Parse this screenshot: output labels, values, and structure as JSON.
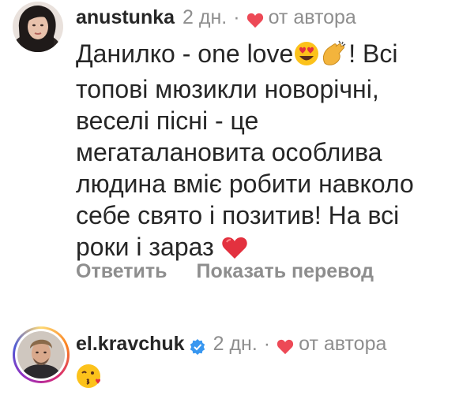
{
  "comments": [
    {
      "username": "anustunka",
      "time": "2 дн.",
      "separator": "·",
      "liked_by_author": "от автора",
      "lines": [
        "Данилко - one love",
        "! Всі",
        "топові мюзикли новорічні,",
        "веселі пісні - це",
        "мегаталановита особлива",
        "людина вміє робити навколо",
        "себе свято і позитив! На всі",
        "роки і зараз"
      ],
      "reply_label": "Ответить",
      "translate_label": "Показать перевод"
    },
    {
      "username": "el.kravchuk",
      "verified": true,
      "time": "2 дн.",
      "separator": "·",
      "liked_by_author": "от автора"
    }
  ],
  "icons": {
    "heart_color": "#ed4956",
    "verified_color": "#3897f0"
  }
}
